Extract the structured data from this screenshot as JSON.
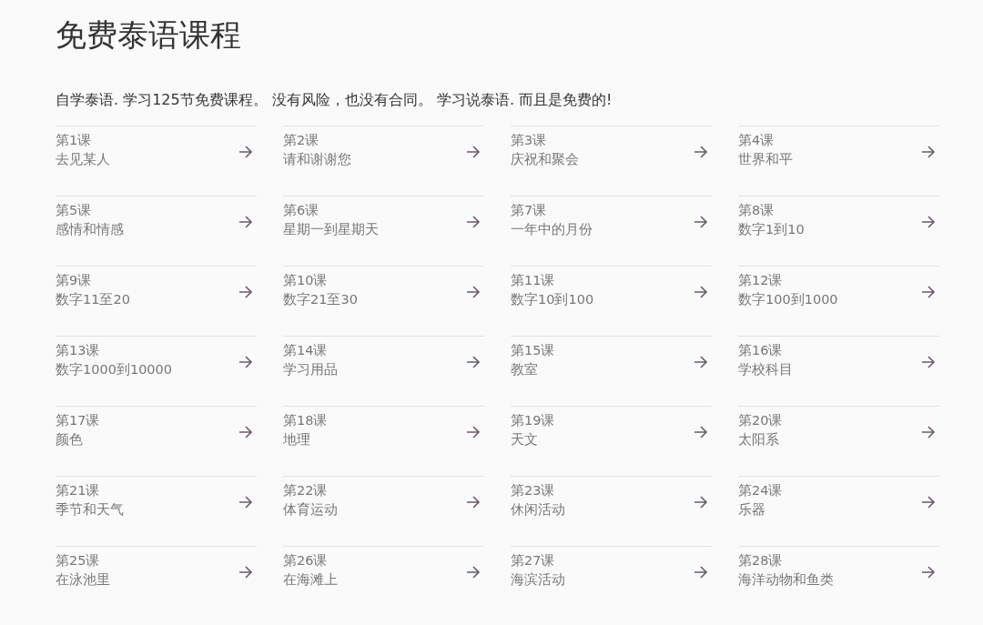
{
  "title": "免费泰语课程",
  "intro": "自学泰语. 学习125节免费课程。 没有风险，也没有合同。 学习说泰语. 而且是免费的!",
  "lessons": [
    {
      "number": "第1课",
      "topic": "去见某人"
    },
    {
      "number": "第2课",
      "topic": "请和谢谢您"
    },
    {
      "number": "第3课",
      "topic": "庆祝和聚会"
    },
    {
      "number": "第4课",
      "topic": "世界和平"
    },
    {
      "number": "第5课",
      "topic": "感情和情感"
    },
    {
      "number": "第6课",
      "topic": "星期一到星期天"
    },
    {
      "number": "第7课",
      "topic": "一年中的月份"
    },
    {
      "number": "第8课",
      "topic": "数字1到10"
    },
    {
      "number": "第9课",
      "topic": "数字11至20"
    },
    {
      "number": "第10课",
      "topic": "数字21至30"
    },
    {
      "number": "第11课",
      "topic": "数字10到100"
    },
    {
      "number": "第12课",
      "topic": "数字100到1000"
    },
    {
      "number": "第13课",
      "topic": "数字1000到10000"
    },
    {
      "number": "第14课",
      "topic": "学习用品"
    },
    {
      "number": "第15课",
      "topic": "教室"
    },
    {
      "number": "第16课",
      "topic": "学校科目"
    },
    {
      "number": "第17课",
      "topic": "颜色"
    },
    {
      "number": "第18课",
      "topic": "地理"
    },
    {
      "number": "第19课",
      "topic": "天文"
    },
    {
      "number": "第20课",
      "topic": "太阳系"
    },
    {
      "number": "第21课",
      "topic": "季节和天气"
    },
    {
      "number": "第22课",
      "topic": "体育运动"
    },
    {
      "number": "第23课",
      "topic": "休闲活动"
    },
    {
      "number": "第24课",
      "topic": "乐器"
    },
    {
      "number": "第25课",
      "topic": "在泳池里"
    },
    {
      "number": "第26课",
      "topic": "在海滩上"
    },
    {
      "number": "第27课",
      "topic": "海滨活动"
    },
    {
      "number": "第28课",
      "topic": "海洋动物和鱼类"
    }
  ]
}
